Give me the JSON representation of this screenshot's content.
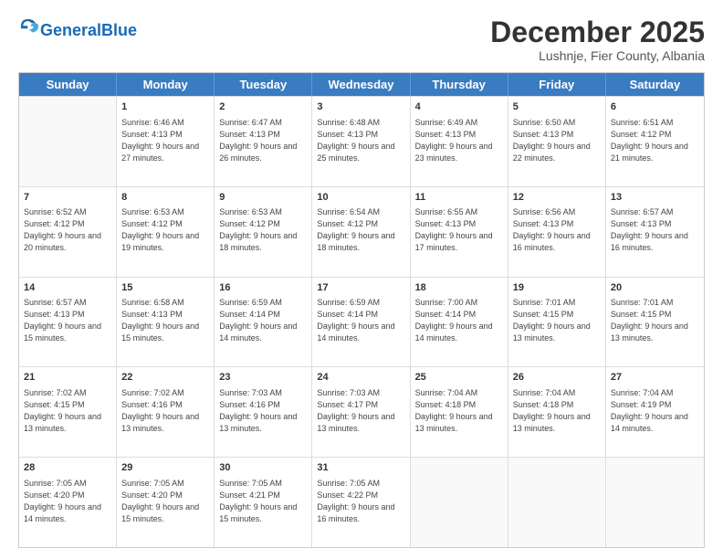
{
  "header": {
    "logo_general": "General",
    "logo_blue": "Blue",
    "title": "December 2025",
    "location": "Lushnje, Fier County, Albania"
  },
  "days_of_week": [
    "Sunday",
    "Monday",
    "Tuesday",
    "Wednesday",
    "Thursday",
    "Friday",
    "Saturday"
  ],
  "weeks": [
    [
      {
        "day": "",
        "sunrise": "",
        "sunset": "",
        "daylight": ""
      },
      {
        "day": "1",
        "sunrise": "Sunrise: 6:46 AM",
        "sunset": "Sunset: 4:13 PM",
        "daylight": "Daylight: 9 hours and 27 minutes."
      },
      {
        "day": "2",
        "sunrise": "Sunrise: 6:47 AM",
        "sunset": "Sunset: 4:13 PM",
        "daylight": "Daylight: 9 hours and 26 minutes."
      },
      {
        "day": "3",
        "sunrise": "Sunrise: 6:48 AM",
        "sunset": "Sunset: 4:13 PM",
        "daylight": "Daylight: 9 hours and 25 minutes."
      },
      {
        "day": "4",
        "sunrise": "Sunrise: 6:49 AM",
        "sunset": "Sunset: 4:13 PM",
        "daylight": "Daylight: 9 hours and 23 minutes."
      },
      {
        "day": "5",
        "sunrise": "Sunrise: 6:50 AM",
        "sunset": "Sunset: 4:13 PM",
        "daylight": "Daylight: 9 hours and 22 minutes."
      },
      {
        "day": "6",
        "sunrise": "Sunrise: 6:51 AM",
        "sunset": "Sunset: 4:12 PM",
        "daylight": "Daylight: 9 hours and 21 minutes."
      }
    ],
    [
      {
        "day": "7",
        "sunrise": "Sunrise: 6:52 AM",
        "sunset": "Sunset: 4:12 PM",
        "daylight": "Daylight: 9 hours and 20 minutes."
      },
      {
        "day": "8",
        "sunrise": "Sunrise: 6:53 AM",
        "sunset": "Sunset: 4:12 PM",
        "daylight": "Daylight: 9 hours and 19 minutes."
      },
      {
        "day": "9",
        "sunrise": "Sunrise: 6:53 AM",
        "sunset": "Sunset: 4:12 PM",
        "daylight": "Daylight: 9 hours and 18 minutes."
      },
      {
        "day": "10",
        "sunrise": "Sunrise: 6:54 AM",
        "sunset": "Sunset: 4:12 PM",
        "daylight": "Daylight: 9 hours and 18 minutes."
      },
      {
        "day": "11",
        "sunrise": "Sunrise: 6:55 AM",
        "sunset": "Sunset: 4:13 PM",
        "daylight": "Daylight: 9 hours and 17 minutes."
      },
      {
        "day": "12",
        "sunrise": "Sunrise: 6:56 AM",
        "sunset": "Sunset: 4:13 PM",
        "daylight": "Daylight: 9 hours and 16 minutes."
      },
      {
        "day": "13",
        "sunrise": "Sunrise: 6:57 AM",
        "sunset": "Sunset: 4:13 PM",
        "daylight": "Daylight: 9 hours and 16 minutes."
      }
    ],
    [
      {
        "day": "14",
        "sunrise": "Sunrise: 6:57 AM",
        "sunset": "Sunset: 4:13 PM",
        "daylight": "Daylight: 9 hours and 15 minutes."
      },
      {
        "day": "15",
        "sunrise": "Sunrise: 6:58 AM",
        "sunset": "Sunset: 4:13 PM",
        "daylight": "Daylight: 9 hours and 15 minutes."
      },
      {
        "day": "16",
        "sunrise": "Sunrise: 6:59 AM",
        "sunset": "Sunset: 4:14 PM",
        "daylight": "Daylight: 9 hours and 14 minutes."
      },
      {
        "day": "17",
        "sunrise": "Sunrise: 6:59 AM",
        "sunset": "Sunset: 4:14 PM",
        "daylight": "Daylight: 9 hours and 14 minutes."
      },
      {
        "day": "18",
        "sunrise": "Sunrise: 7:00 AM",
        "sunset": "Sunset: 4:14 PM",
        "daylight": "Daylight: 9 hours and 14 minutes."
      },
      {
        "day": "19",
        "sunrise": "Sunrise: 7:01 AM",
        "sunset": "Sunset: 4:15 PM",
        "daylight": "Daylight: 9 hours and 13 minutes."
      },
      {
        "day": "20",
        "sunrise": "Sunrise: 7:01 AM",
        "sunset": "Sunset: 4:15 PM",
        "daylight": "Daylight: 9 hours and 13 minutes."
      }
    ],
    [
      {
        "day": "21",
        "sunrise": "Sunrise: 7:02 AM",
        "sunset": "Sunset: 4:15 PM",
        "daylight": "Daylight: 9 hours and 13 minutes."
      },
      {
        "day": "22",
        "sunrise": "Sunrise: 7:02 AM",
        "sunset": "Sunset: 4:16 PM",
        "daylight": "Daylight: 9 hours and 13 minutes."
      },
      {
        "day": "23",
        "sunrise": "Sunrise: 7:03 AM",
        "sunset": "Sunset: 4:16 PM",
        "daylight": "Daylight: 9 hours and 13 minutes."
      },
      {
        "day": "24",
        "sunrise": "Sunrise: 7:03 AM",
        "sunset": "Sunset: 4:17 PM",
        "daylight": "Daylight: 9 hours and 13 minutes."
      },
      {
        "day": "25",
        "sunrise": "Sunrise: 7:04 AM",
        "sunset": "Sunset: 4:18 PM",
        "daylight": "Daylight: 9 hours and 13 minutes."
      },
      {
        "day": "26",
        "sunrise": "Sunrise: 7:04 AM",
        "sunset": "Sunset: 4:18 PM",
        "daylight": "Daylight: 9 hours and 13 minutes."
      },
      {
        "day": "27",
        "sunrise": "Sunrise: 7:04 AM",
        "sunset": "Sunset: 4:19 PM",
        "daylight": "Daylight: 9 hours and 14 minutes."
      }
    ],
    [
      {
        "day": "28",
        "sunrise": "Sunrise: 7:05 AM",
        "sunset": "Sunset: 4:20 PM",
        "daylight": "Daylight: 9 hours and 14 minutes."
      },
      {
        "day": "29",
        "sunrise": "Sunrise: 7:05 AM",
        "sunset": "Sunset: 4:20 PM",
        "daylight": "Daylight: 9 hours and 15 minutes."
      },
      {
        "day": "30",
        "sunrise": "Sunrise: 7:05 AM",
        "sunset": "Sunset: 4:21 PM",
        "daylight": "Daylight: 9 hours and 15 minutes."
      },
      {
        "day": "31",
        "sunrise": "Sunrise: 7:05 AM",
        "sunset": "Sunset: 4:22 PM",
        "daylight": "Daylight: 9 hours and 16 minutes."
      },
      {
        "day": "",
        "sunrise": "",
        "sunset": "",
        "daylight": ""
      },
      {
        "day": "",
        "sunrise": "",
        "sunset": "",
        "daylight": ""
      },
      {
        "day": "",
        "sunrise": "",
        "sunset": "",
        "daylight": ""
      }
    ]
  ]
}
